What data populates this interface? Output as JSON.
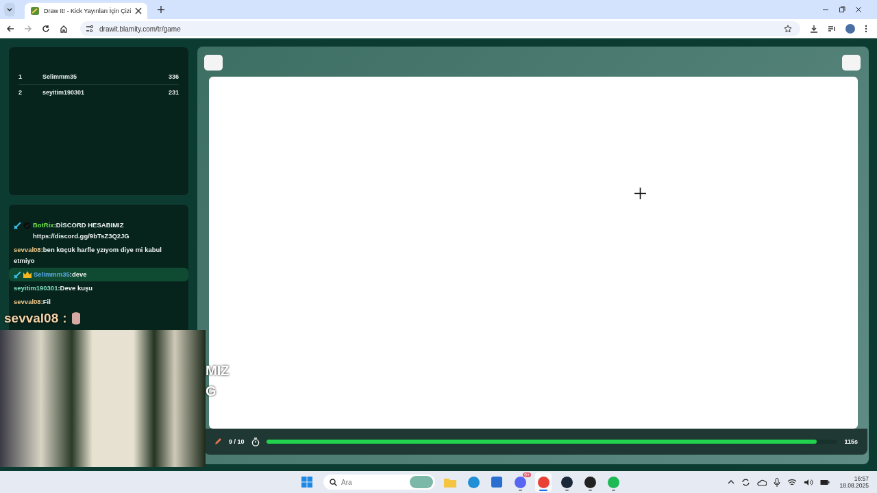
{
  "browser": {
    "tab_title": "Draw It! - Kick Yayınları İçin Çizi",
    "url": "drawit.blamity.com/tr/game"
  },
  "leaderboard": [
    {
      "rank": "1",
      "name": "Selimmm35",
      "score": "336"
    },
    {
      "rank": "2",
      "name": "seyitim190301",
      "score": "231"
    }
  ],
  "chat": [
    {
      "badges": [
        {
          "kind": "sword"
        },
        {
          "kind": "verified"
        }
      ],
      "user": "BotRix",
      "color": "#6ee04a",
      "text": ":DİSCORD HESABIMIZ https://discord.gg/9bTsZ3Q2JG",
      "highlighted": false
    },
    {
      "user": "sevval08",
      "color": "#f0c98a",
      "text": ":ben küçük harfle yzıyom diye mi kabul etmiyo",
      "highlighted": false
    },
    {
      "badges": [
        {
          "kind": "sword"
        },
        {
          "kind": "crown"
        }
      ],
      "user": "Selimmm35",
      "color": "#5aa9e6",
      "text": ":deve",
      "highlighted": true
    },
    {
      "user": "seyitim190301",
      "color": "#7fe0c0",
      "text": ":Deve kuşu",
      "highlighted": false
    },
    {
      "user": "sevval08",
      "color": "#f0c98a",
      "text": ":Fil",
      "highlighted": false
    }
  ],
  "overlay": {
    "user": "sevval08",
    "separator": ":",
    "text_lines": [
      "MIZ",
      "G"
    ]
  },
  "game": {
    "round": "9 / 10",
    "level": 0.964,
    "time": "115s"
  },
  "taskbar": {
    "search_placeholder": "Ara",
    "apps": [
      {
        "kind": "folder",
        "selected": false,
        "open": false
      },
      {
        "kind": "edge",
        "selected": false,
        "open": false
      },
      {
        "kind": "store",
        "selected": false,
        "open": false
      },
      {
        "kind": "discord",
        "selected": false,
        "open": true,
        "badge": "9+"
      },
      {
        "kind": "chrome",
        "selected": true,
        "open": true
      },
      {
        "kind": "steam",
        "selected": false,
        "open": true
      },
      {
        "kind": "obs",
        "selected": false,
        "open": true
      },
      {
        "kind": "spotify",
        "selected": false,
        "open": true
      }
    ],
    "time": "16:57",
    "date": "18.08.2025"
  }
}
